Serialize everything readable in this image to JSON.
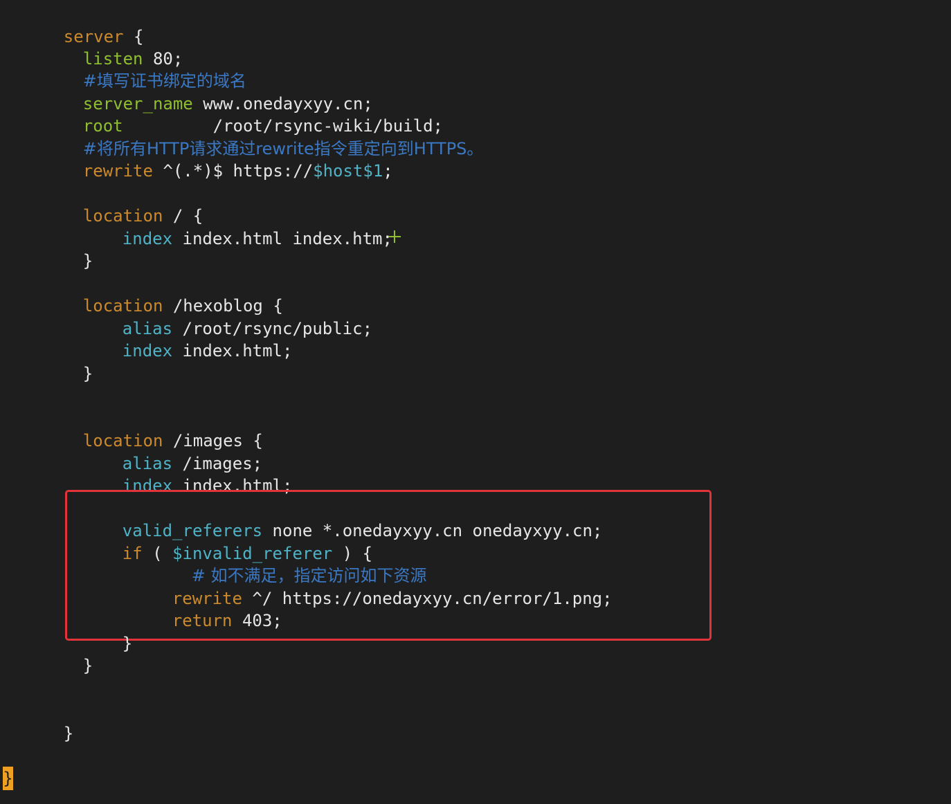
{
  "editor": {
    "lines": {
      "l1": {
        "a": "server",
        "b": " {"
      },
      "l2": {
        "a": "listen",
        "b": " 80;"
      },
      "l3": {
        "c": "#填写证书绑定的域名"
      },
      "l4": {
        "a": "server_name",
        "b": " www.onedayxyy.cn;"
      },
      "l5": {
        "a": "root",
        "b": "         /root/rsync-wiki/build;"
      },
      "l6": {
        "c": "#将所有HTTP请求通过rewrite指令重定向到HTTPS。"
      },
      "l7": {
        "a": "rewrite",
        "b": " ^(.*)$ https://",
        "v": "$host$1",
        "e": ";"
      },
      "l8": {
        "a": "location",
        "b": " / {"
      },
      "l9": {
        "a": "index",
        "b": " index.html index.htm;"
      },
      "l10": {
        "b": "}"
      },
      "l11": {
        "a": "location",
        "b": " /hexoblog {"
      },
      "l12": {
        "a": "alias",
        "b": " /root/rsync/public;"
      },
      "l13": {
        "a": "index",
        "b": " index.html;"
      },
      "l14": {
        "b": "}"
      },
      "l15": {
        "a": "location",
        "b": " /images {"
      },
      "l16": {
        "a": "alias",
        "b": " /images;"
      },
      "l17": {
        "a": "index",
        "b": " index.html;"
      },
      "l18": {
        "a": "valid_referers",
        "b": " none *.onedayxyy.cn onedayxyy.cn;"
      },
      "l19": {
        "a": "if",
        "b": " ( ",
        "v": "$invalid_referer",
        "e": " ) {"
      },
      "l20": {
        "c": "# 如不满足，指定访问如下资源"
      },
      "l21": {
        "a": "rewrite",
        "b": " ^/ https://onedayxyy.cn/error/1.png;"
      },
      "l22": {
        "a": "return",
        "b": " 403;"
      },
      "l23": {
        "b": "}"
      },
      "l24": {
        "b": "}"
      },
      "l25": {
        "b": "}"
      }
    },
    "cursor_char": "}",
    "colors": {
      "background": "#1e1e1e",
      "directive": "#cc8a2c",
      "green_keyword": "#8fbf2f",
      "cyan_keyword": "#4fb3c7",
      "comment": "#3b78c4",
      "highlight_border": "#e0343a",
      "cursor": "#f0a020"
    }
  }
}
